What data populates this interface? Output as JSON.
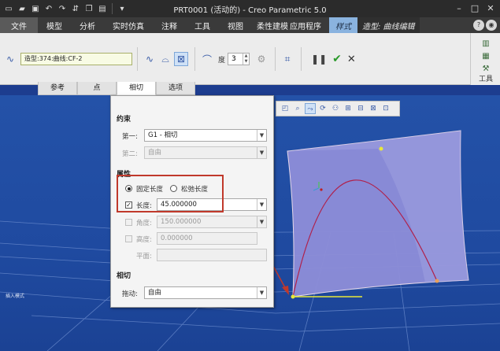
{
  "window": {
    "title": "PRT0001 (活动的) - Creo Parametric 5.0"
  },
  "menu": {
    "items": [
      "文件",
      "模型",
      "分析",
      "实时仿真",
      "注释",
      "工具",
      "视图",
      "柔性建模",
      "应用程序"
    ],
    "style_tab": "样式",
    "context_tab": "造型: 曲线编辑"
  },
  "ribbon": {
    "reference_value": "造型:374:曲线:CF-2",
    "degree_label": "度",
    "degree_value": "3",
    "tools_label": "工具"
  },
  "subtabs": [
    "参考",
    "点",
    "相切",
    "选项"
  ],
  "panel": {
    "constraint_heading": "约束",
    "first_label": "第一:",
    "first_value": "G1 - 相切",
    "second_label": "第二:",
    "second_value": "自由",
    "property_heading": "属性",
    "fixed_length_label": "固定长度",
    "relaxed_length_label": "松弛长度",
    "length_label": "长度:",
    "length_value": "45.000000",
    "angle_label": "角度:",
    "angle_value": "150.000000",
    "height_label": "高度:",
    "height_value": "0.000000",
    "plane_label": "平面:",
    "tangent_heading": "相切",
    "drag_label": "拖动:",
    "drag_value": "自由"
  },
  "status": {
    "left_text": "插入模式"
  },
  "colors": {
    "background": "#1f4aa0",
    "style_tab": "#8ab3df",
    "accent_red": "#c0392b",
    "surface": "#8f8fd6"
  },
  "icons": {
    "ok": "check-icon",
    "cancel": "close-icon",
    "pause": "pause-icon"
  }
}
